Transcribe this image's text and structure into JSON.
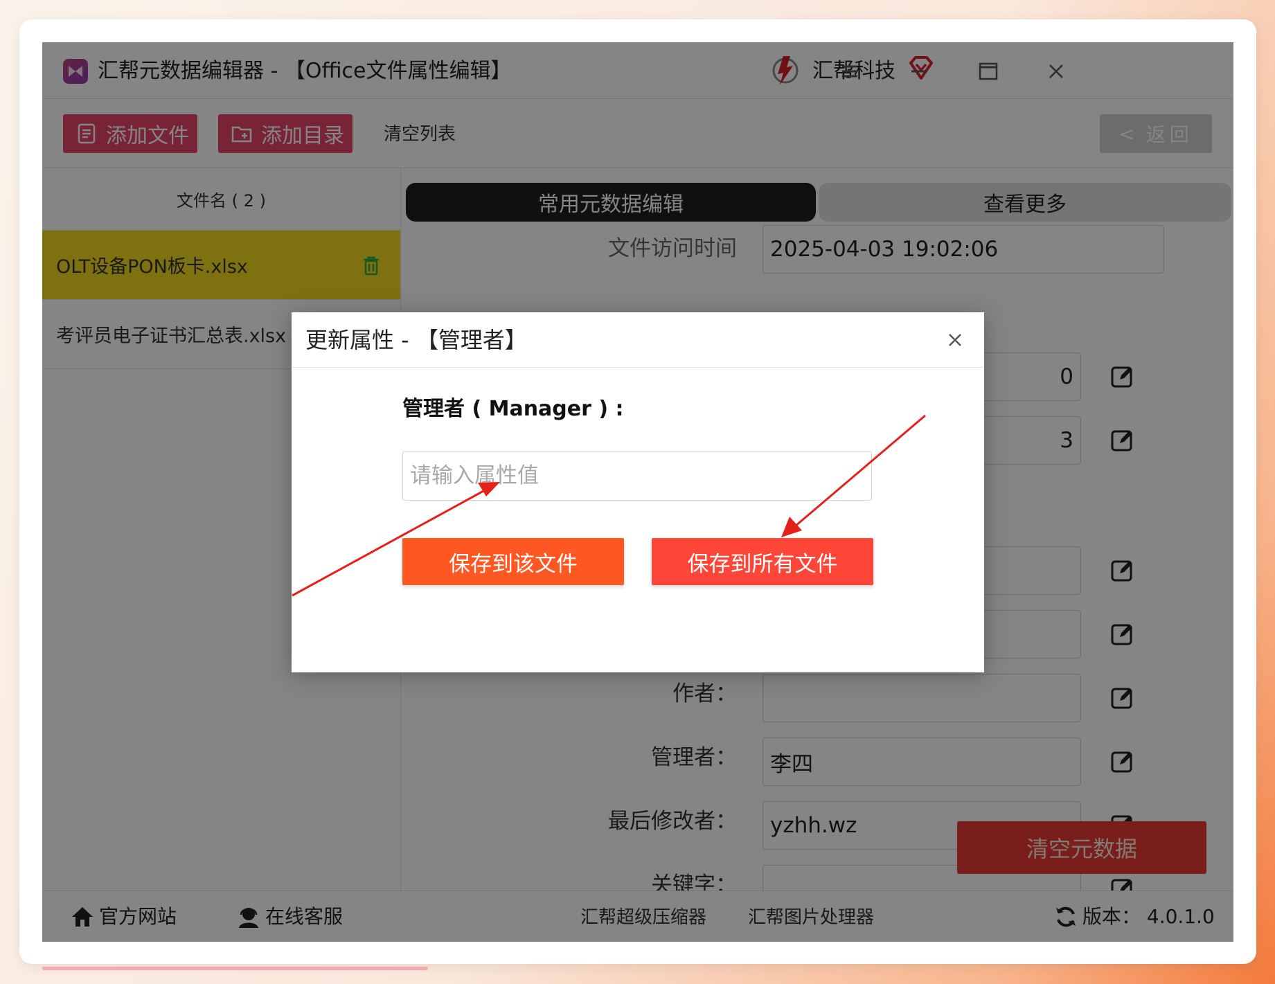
{
  "window": {
    "app_title": "汇帮元数据编辑器 - 【Office文件属性编辑】",
    "brand": "汇帮科技"
  },
  "toolbar": {
    "add_file": "添加文件",
    "add_dir": "添加目录",
    "clear_list": "清空列表",
    "back": "返回"
  },
  "file_list": {
    "header": "文件名 ( 2 )",
    "items": [
      {
        "name": "OLT设备PON板卡.xlsx",
        "selected": true
      },
      {
        "name": "考评员电子证书汇总表.xlsx",
        "selected": false
      }
    ]
  },
  "tabs": {
    "common": "常用元数据编辑",
    "more": "查看更多"
  },
  "fields": {
    "access_time_label": "文件访问时间",
    "access_time_value": "2025-04-03 19:02:06",
    "partial_1": "0",
    "partial_2": "3",
    "author_label": "作者：",
    "author_value": "",
    "manager_label": "管理者：",
    "manager_value": "李四",
    "last_modified_by_label": "最后修改者：",
    "last_modified_by_value": "yzhh.wz",
    "keywords_label": "关键字：",
    "keywords_value": ""
  },
  "clear_metadata": "清空元数据",
  "statusbar": {
    "website": "官方网站",
    "support": "在线客服",
    "compressor": "汇帮超级压缩器",
    "image_tool": "汇帮图片处理器",
    "version": "版本：  4.0.1.0"
  },
  "dialog": {
    "title": "更新属性 - 【管理者】",
    "field_label": "管理者 ( Manager ) :",
    "placeholder": "请输入属性值",
    "value": "",
    "save_this": "保存到该文件",
    "save_all": "保存到所有文件"
  },
  "colors": {
    "accent_pink": "#e8436a",
    "selected_row": "#f0d91f",
    "btn_this": "#fe5722",
    "btn_all": "#fd4538",
    "clear_meta": "#e83a34",
    "arrow": "#e5201b"
  }
}
